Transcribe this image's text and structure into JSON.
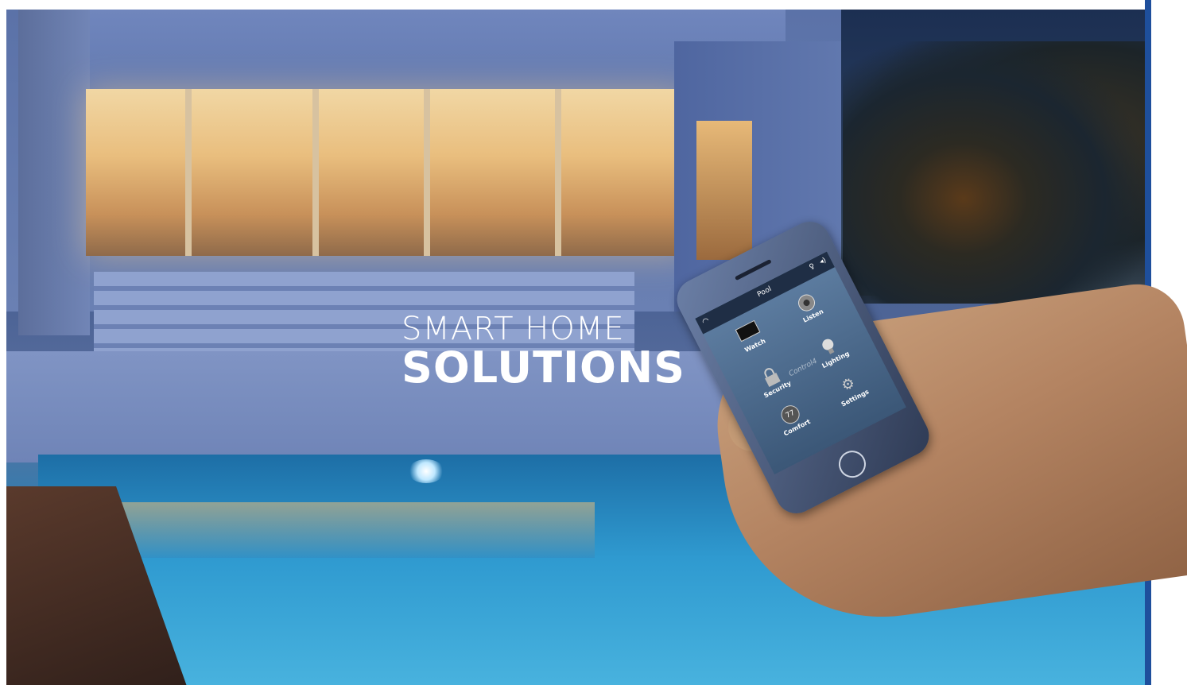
{
  "hero": {
    "line1": "SMART HOME",
    "line2": "SOLUTIONS"
  },
  "phone": {
    "status": {
      "wifi_icon": "wifi-icon",
      "title": "Pool",
      "bulb_icon": "bulb-icon",
      "volume_icon": "volume-icon"
    },
    "brand": "Control4",
    "tiles": [
      {
        "label": "Watch",
        "icon": "tv-icon"
      },
      {
        "label": "Listen",
        "icon": "speaker-icon"
      },
      {
        "label": "Security",
        "icon": "lock-icon"
      },
      {
        "label": "Lighting",
        "icon": "bulb-icon"
      },
      {
        "label": "Comfort",
        "icon": "thermostat-icon",
        "value": "77"
      },
      {
        "label": "Settings",
        "icon": "gear-icon"
      }
    ]
  },
  "colors": {
    "accent_bar": "#1e4f9c",
    "headline": "#ffffff"
  }
}
